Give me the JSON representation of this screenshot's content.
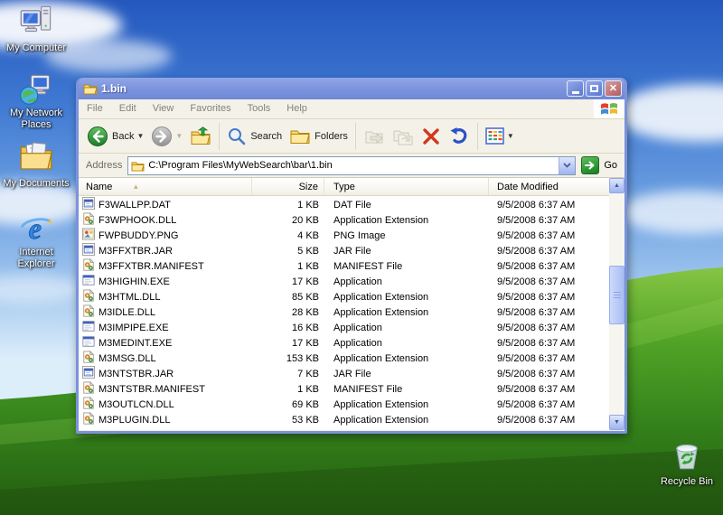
{
  "desktop": {
    "icons": [
      {
        "key": "my-computer",
        "label": "My Computer"
      },
      {
        "key": "my-network-places",
        "label": "My Network Places"
      },
      {
        "key": "my-documents",
        "label": "My Documents"
      },
      {
        "key": "internet-explorer",
        "label": "Internet Explorer"
      },
      {
        "key": "recycle-bin",
        "label": "Recycle Bin"
      }
    ]
  },
  "window": {
    "title": "1.bin",
    "menu": [
      "File",
      "Edit",
      "View",
      "Favorites",
      "Tools",
      "Help"
    ],
    "toolbar": {
      "back_label": "Back",
      "search_label": "Search",
      "folders_label": "Folders"
    },
    "address": {
      "label": "Address",
      "value": "C:\\Program Files\\MyWebSearch\\bar\\1.bin",
      "go_label": "Go"
    },
    "columns": {
      "name": "Name",
      "size": "Size",
      "type": "Type",
      "modified": "Date Modified"
    },
    "files": [
      {
        "icon": "dat",
        "name": "F3WALLPP.DAT",
        "size": "1 KB",
        "type": "DAT File",
        "modified": "9/5/2008 6:37 AM"
      },
      {
        "icon": "dll",
        "name": "F3WPHOOK.DLL",
        "size": "20 KB",
        "type": "Application Extension",
        "modified": "9/5/2008 6:37 AM"
      },
      {
        "icon": "png",
        "name": "FWPBUDDY.PNG",
        "size": "4 KB",
        "type": "PNG Image",
        "modified": "9/5/2008 6:37 AM"
      },
      {
        "icon": "dat",
        "name": "M3FFXTBR.JAR",
        "size": "5 KB",
        "type": "JAR File",
        "modified": "9/5/2008 6:37 AM"
      },
      {
        "icon": "dll",
        "name": "M3FFXTBR.MANIFEST",
        "size": "1 KB",
        "type": "MANIFEST File",
        "modified": "9/5/2008 6:37 AM"
      },
      {
        "icon": "exe",
        "name": "M3HIGHIN.EXE",
        "size": "17 KB",
        "type": "Application",
        "modified": "9/5/2008 6:37 AM"
      },
      {
        "icon": "dll",
        "name": "M3HTML.DLL",
        "size": "85 KB",
        "type": "Application Extension",
        "modified": "9/5/2008 6:37 AM"
      },
      {
        "icon": "dll",
        "name": "M3IDLE.DLL",
        "size": "28 KB",
        "type": "Application Extension",
        "modified": "9/5/2008 6:37 AM"
      },
      {
        "icon": "exe",
        "name": "M3IMPIPE.EXE",
        "size": "16 KB",
        "type": "Application",
        "modified": "9/5/2008 6:37 AM"
      },
      {
        "icon": "exe",
        "name": "M3MEDINT.EXE",
        "size": "17 KB",
        "type": "Application",
        "modified": "9/5/2008 6:37 AM"
      },
      {
        "icon": "dll",
        "name": "M3MSG.DLL",
        "size": "153 KB",
        "type": "Application Extension",
        "modified": "9/5/2008 6:37 AM"
      },
      {
        "icon": "dat",
        "name": "M3NTSTBR.JAR",
        "size": "7 KB",
        "type": "JAR File",
        "modified": "9/5/2008 6:37 AM"
      },
      {
        "icon": "dll",
        "name": "M3NTSTBR.MANIFEST",
        "size": "1 KB",
        "type": "MANIFEST File",
        "modified": "9/5/2008 6:37 AM"
      },
      {
        "icon": "dll",
        "name": "M3OUTLCN.DLL",
        "size": "69 KB",
        "type": "Application Extension",
        "modified": "9/5/2008 6:37 AM"
      },
      {
        "icon": "dll",
        "name": "M3PLUGIN.DLL",
        "size": "53 KB",
        "type": "Application Extension",
        "modified": "9/5/2008 6:37 AM"
      }
    ]
  },
  "colors": {
    "titlebar_blue": "#7e96de",
    "toolbar_beige": "#f4f2e8",
    "go_green": "#2f9e39",
    "delete_red": "#d0391f",
    "undo_blue": "#2b50c8",
    "scrollbar_blue": "#bccbf8"
  }
}
